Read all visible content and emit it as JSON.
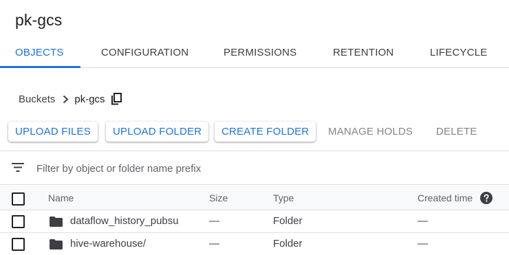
{
  "bucket": {
    "title": "pk-gcs"
  },
  "tabs": [
    {
      "label": "OBJECTS",
      "active": true
    },
    {
      "label": "CONFIGURATION",
      "active": false
    },
    {
      "label": "PERMISSIONS",
      "active": false
    },
    {
      "label": "RETENTION",
      "active": false
    },
    {
      "label": "LIFECYCLE",
      "active": false
    }
  ],
  "breadcrumb": {
    "root": "Buckets",
    "current": "pk-gcs",
    "separator_icon": "chevron-right-icon",
    "copy_icon": "copy-icon"
  },
  "actions": {
    "upload_files": "UPLOAD FILES",
    "upload_folder": "UPLOAD FOLDER",
    "create_folder": "CREATE FOLDER",
    "manage_holds": "MANAGE HOLDS",
    "delete": "DELETE"
  },
  "filter": {
    "placeholder": "Filter by object or folder name prefix",
    "value": "",
    "icon": "filter-list-icon"
  },
  "table": {
    "columns": {
      "name": "Name",
      "size": "Size",
      "type": "Type",
      "created": "Created time"
    },
    "help_icon": "help-icon",
    "rows": [
      {
        "name": "dataflow_history_pubsu",
        "size": "—",
        "type": "Folder",
        "created": "—",
        "icon": "folder-icon"
      },
      {
        "name": "hive-warehouse/",
        "size": "—",
        "type": "Folder",
        "created": "—",
        "icon": "folder-icon"
      }
    ]
  },
  "colors": {
    "accent": "#1a73e8",
    "text": "#202124",
    "muted": "#5f6368",
    "disabled": "#80868b",
    "divider": "#dadce0",
    "header_bg": "#f8f9fa"
  }
}
